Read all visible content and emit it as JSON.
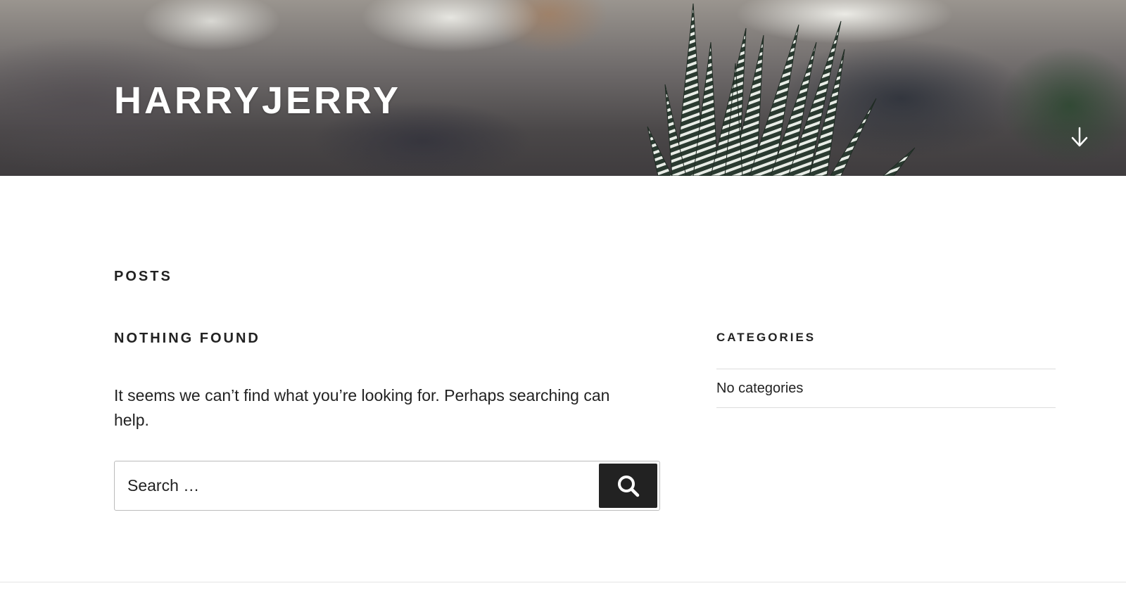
{
  "site": {
    "title": "HARRYJERRY"
  },
  "header": {
    "scroll_icon": "arrow-down-icon"
  },
  "main": {
    "page_title": "POSTS",
    "section_title": "NOTHING FOUND",
    "message": "It seems we can’t find what you’re looking for. Perhaps searching can help.",
    "search": {
      "placeholder": "Search …",
      "value": "",
      "button_icon": "search-icon"
    }
  },
  "sidebar": {
    "categories": {
      "title": "CATEGORIES",
      "items": [
        "No categories"
      ]
    }
  },
  "colors": {
    "text": "#222222",
    "button_bg": "#222222",
    "divider": "#dddddd",
    "header_title": "#ffffff"
  }
}
